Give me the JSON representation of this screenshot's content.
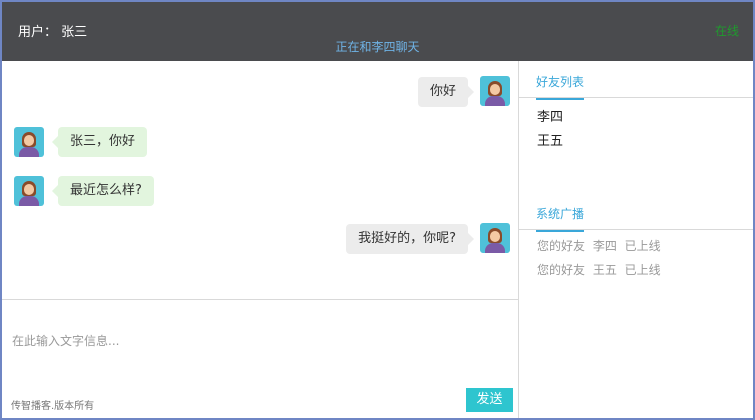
{
  "header": {
    "user_label": "用户： 张三",
    "chat_status": "正在和李四聊天",
    "online_status": "在线"
  },
  "messages": [
    {
      "side": "out",
      "text": "你好"
    },
    {
      "side": "in",
      "text": "张三，你好"
    },
    {
      "side": "in",
      "text": "最近怎么样?"
    },
    {
      "side": "out",
      "text": "我挺好的，你呢?"
    }
  ],
  "input": {
    "placeholder": "在此输入文字信息...",
    "value": ""
  },
  "footer": {
    "copyright": "传智播客.版本所有",
    "send_label": "发送"
  },
  "friends": {
    "title": "好友列表",
    "items": [
      "李四",
      "王五"
    ]
  },
  "broadcast": {
    "title": "系统广播",
    "items": [
      "您的好友 李四 已上线",
      "您的好友 王五 已上线"
    ]
  },
  "colors": {
    "header_bg": "#4a4b4e",
    "accent": "#3aa7d9",
    "send_button": "#2ec5cf",
    "online": "#1f9b2d",
    "outgoing_bubble": "#ececec",
    "incoming_bubble": "#e2f5de"
  }
}
